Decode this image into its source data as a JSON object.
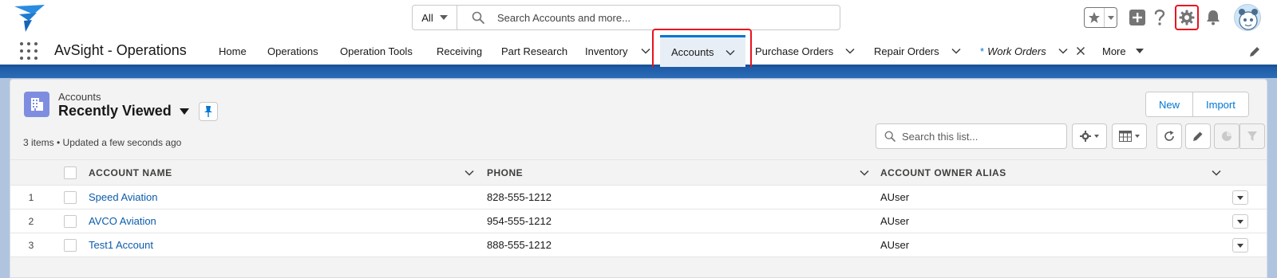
{
  "colors": {
    "brand_blue": "#1b5297",
    "accent": "#0176d3",
    "link": "#0b5cab",
    "highlight_red": "#e8131f",
    "account_icon_bg": "#7f8de1"
  },
  "global_header": {
    "logo_icon": "app-logo-icon",
    "search": {
      "scope_label": "All",
      "placeholder": "Search Accounts and more..."
    },
    "icons": [
      "favorites-star-icon",
      "chevron-down-icon",
      "add-icon",
      "help-icon",
      "setup-gear-icon",
      "notification-bell-icon",
      "avatar"
    ]
  },
  "app_nav": {
    "app_name": "AvSight - Operations",
    "items": [
      {
        "label": "Home"
      },
      {
        "label": "Operations"
      },
      {
        "label": "Operation Tools"
      },
      {
        "label": "Receiving"
      },
      {
        "label": "Part Research"
      },
      {
        "label": "Inventory"
      },
      {
        "label": "Accounts",
        "active": true
      },
      {
        "label": "Purchase Orders"
      },
      {
        "label": "Repair Orders"
      },
      {
        "label": "Work Orders",
        "prefix": "*",
        "italic": true,
        "closable": true
      },
      {
        "label": "More"
      }
    ]
  },
  "list_view": {
    "object_label": "Accounts",
    "view_name": "Recently Viewed",
    "meta": "3 items • Updated a few seconds ago",
    "buttons": {
      "new": "New",
      "import": "Import"
    },
    "search_placeholder": "Search this list...",
    "columns": [
      "Account Name",
      "Phone",
      "Account Owner Alias"
    ],
    "rows": [
      {
        "num": "1",
        "name": "Speed Aviation",
        "phone": "828-555-1212",
        "owner": "AUser"
      },
      {
        "num": "2",
        "name": "AVCO Aviation",
        "phone": "954-555-1212",
        "owner": "AUser"
      },
      {
        "num": "3",
        "name": "Test1 Account",
        "phone": "888-555-1212",
        "owner": "AUser"
      }
    ]
  }
}
